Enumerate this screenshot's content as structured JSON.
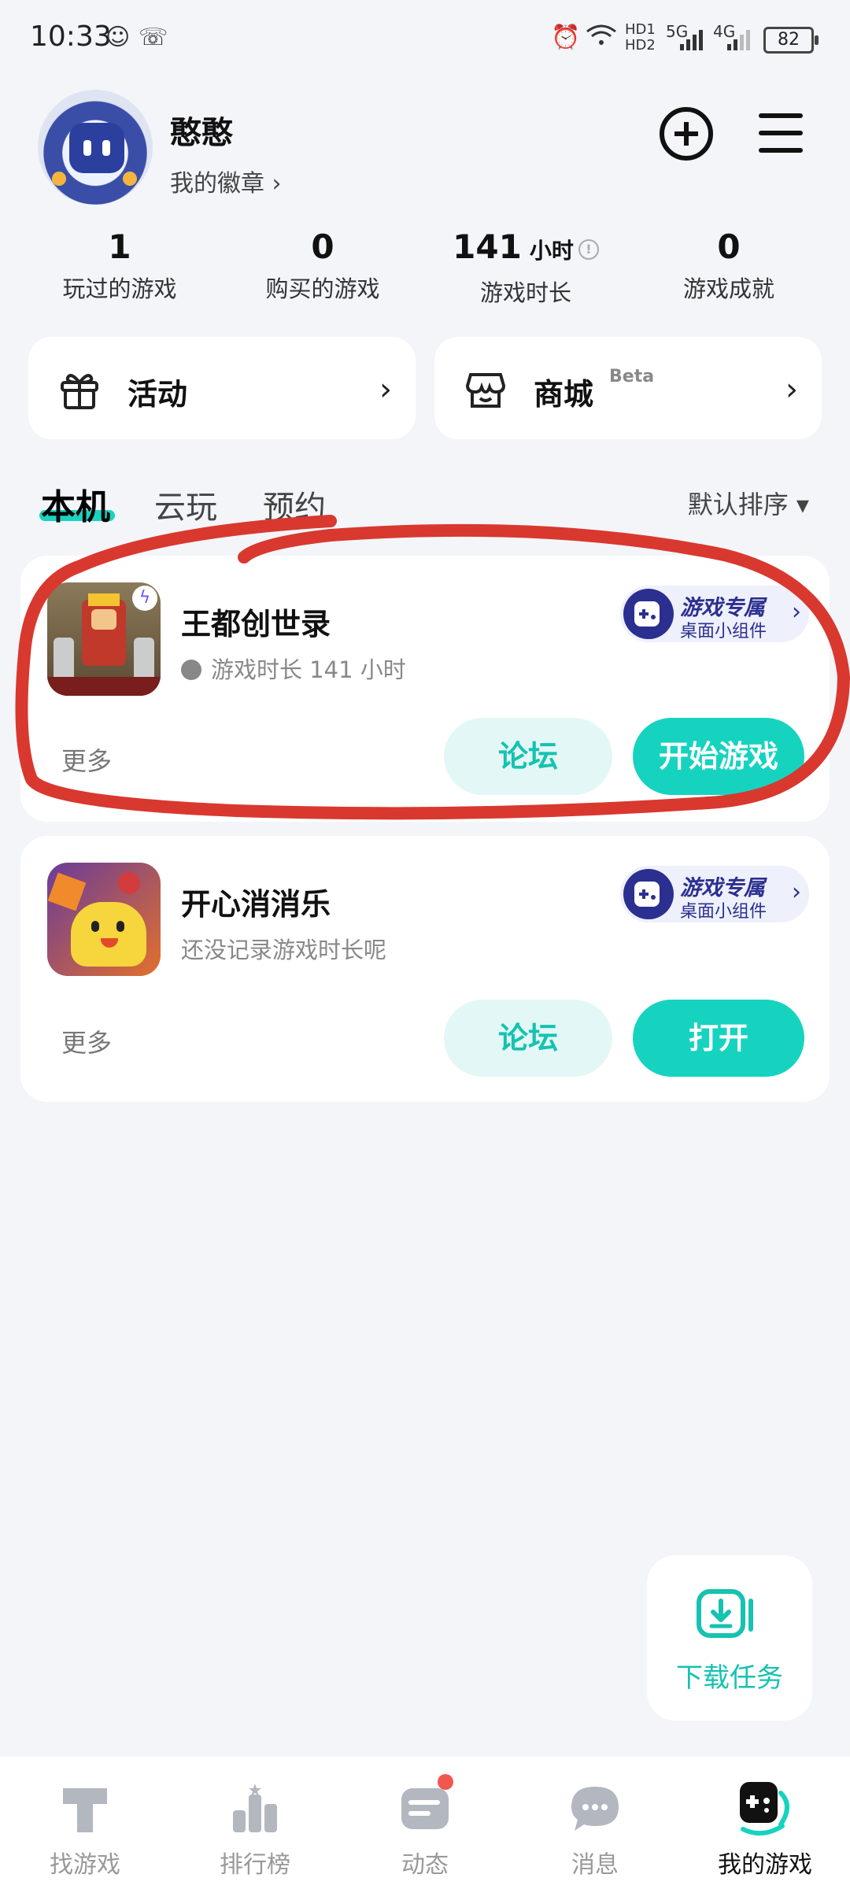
{
  "status_bar": {
    "time": "10:33",
    "battery": "82",
    "network_1": "HD1",
    "network_2": "HD2",
    "net_5g": "5G",
    "net_4g": "4G"
  },
  "profile": {
    "username": "憨憨",
    "badges_link": "我的徽章 ›"
  },
  "stats": [
    {
      "value": "1",
      "unit": "",
      "label": "玩过的游戏"
    },
    {
      "value": "0",
      "unit": "",
      "label": "购买的游戏"
    },
    {
      "value": "141",
      "unit": "小时",
      "label": "游戏时长"
    },
    {
      "value": "0",
      "unit": "",
      "label": "游戏成就"
    }
  ],
  "quick_cards": {
    "activity": "活动",
    "mall": "商城",
    "mall_badge": "Beta"
  },
  "tabs": [
    "本机",
    "云玩",
    "预约"
  ],
  "sort_label": "默认排序 ▾",
  "games": [
    {
      "title": "王都创世录",
      "subtitle": "游戏时长 141 小时",
      "widget_line1": "游戏专属",
      "widget_line2": "桌面小组件",
      "more": "更多",
      "forum": "论坛",
      "action": "开始游戏"
    },
    {
      "title": "开心消消乐",
      "subtitle": "还没记录游戏时长呢",
      "widget_line1": "游戏专属",
      "widget_line2": "桌面小组件",
      "more": "更多",
      "forum": "论坛",
      "action": "打开"
    }
  ],
  "download_fab": "下载任务",
  "nav": [
    "找游戏",
    "排行榜",
    "动态",
    "消息",
    "我的游戏"
  ],
  "colors": {
    "accent": "#16d3c0",
    "widget": "#2b2f8f",
    "annotation": "#d9382f",
    "background": "#f3f5f9"
  }
}
